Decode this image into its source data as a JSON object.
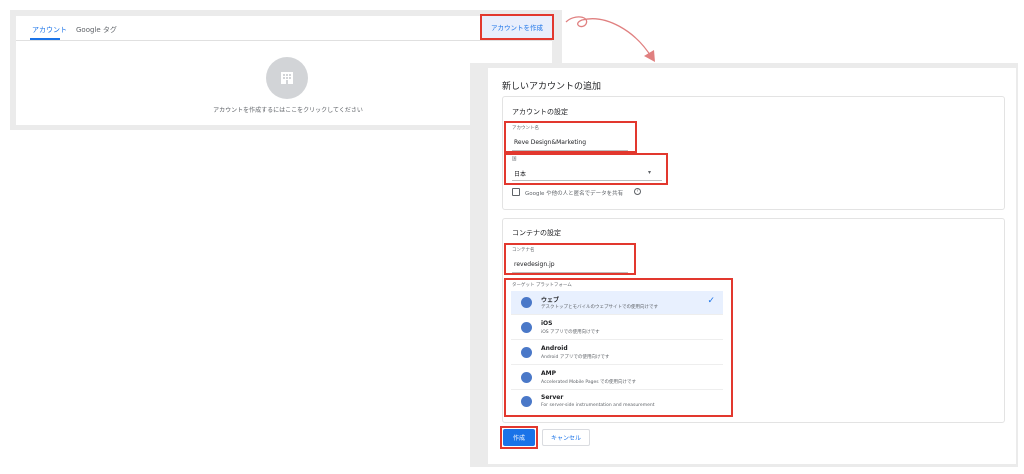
{
  "left_panel": {
    "tabs": [
      {
        "label": "アカウント",
        "active": true
      },
      {
        "label": "Google タグ",
        "active": false
      }
    ],
    "empty_state_text": "アカウントを作成するにはここをクリックしてください",
    "create_account_button": "アカウントを作成"
  },
  "dialog": {
    "title": "新しいアカウントの追加",
    "account_section": {
      "title": "アカウントの設定",
      "account_name_label": "アカウント名",
      "account_name_value": "Reve Design&Marketing",
      "country_label": "国",
      "country_value": "日本",
      "share_label": "Google や他の人と匿名でデータを共有",
      "share_checked": false
    },
    "container_section": {
      "title": "コンテナの設定",
      "container_name_label": "コンテナ名",
      "container_name_value": "revedesign.jp",
      "platform_label": "ターゲット プラットフォーム",
      "platforms": [
        {
          "title": "ウェブ",
          "desc": "デスクトップとモバイルのウェブサイトでの使用向けです",
          "icon": "globe-icon",
          "selected": true
        },
        {
          "title": "iOS",
          "desc": "iOS アプリでの使用向けです",
          "icon": "ios-device-icon",
          "selected": false
        },
        {
          "title": "Android",
          "desc": "Android アプリでの使用向けです",
          "icon": "android-icon",
          "selected": false
        },
        {
          "title": "AMP",
          "desc": "Accelerated Mobile Pages での使用向けです",
          "icon": "amp-bolt-icon",
          "selected": false
        },
        {
          "title": "Server",
          "desc": "For server-side instrumentation and measurement",
          "icon": "cloud-icon",
          "selected": false
        }
      ]
    },
    "buttons": {
      "create": "作成",
      "cancel": "キャンセル"
    }
  },
  "colors": {
    "accent": "#1a73e8",
    "highlight_red": "#e2382e",
    "selected_row": "#e8f0fe"
  }
}
